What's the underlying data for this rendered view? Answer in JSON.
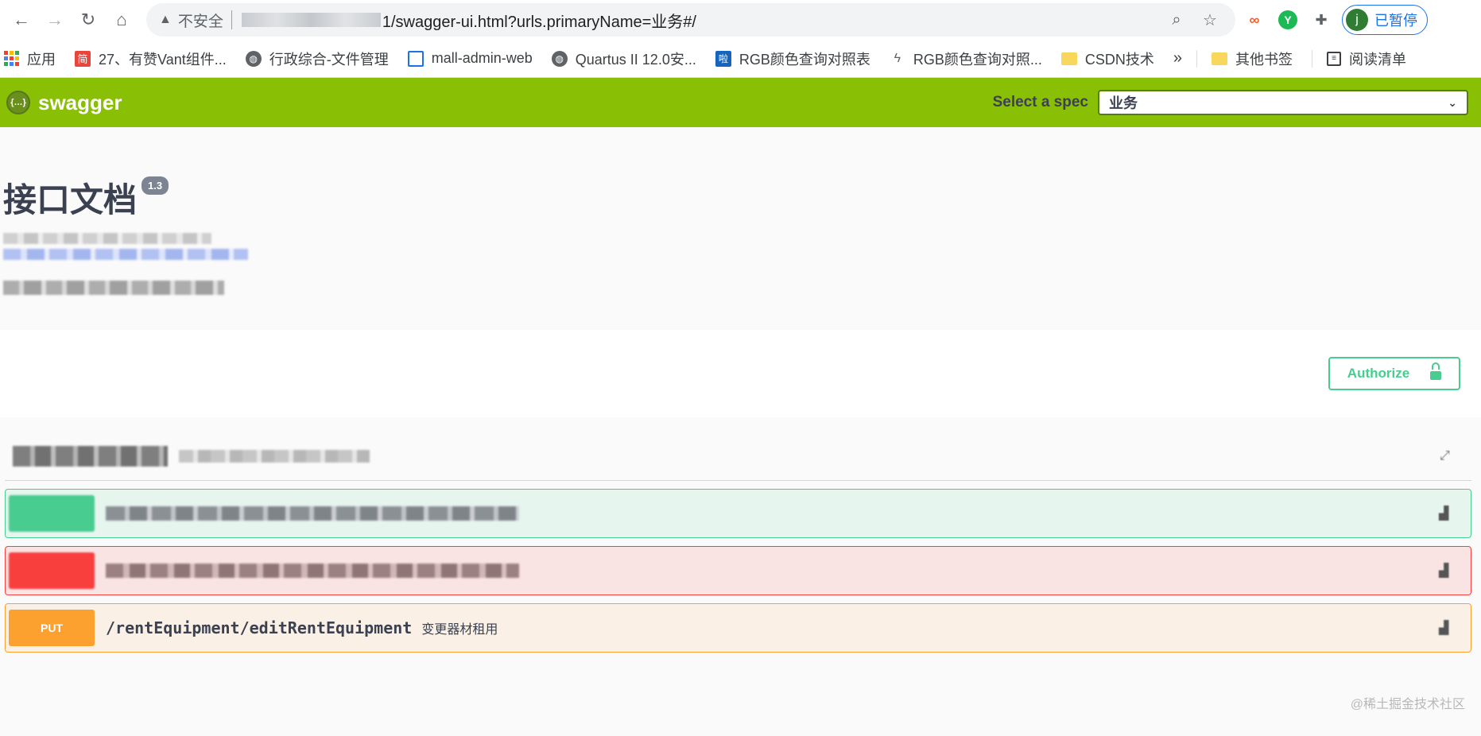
{
  "browser": {
    "insecure_label": "不安全",
    "url_suffix": "1/swagger-ui.html?urls.primaryName=业务#/",
    "profile_initial": "j",
    "profile_label": "已暂停"
  },
  "bookmarks": [
    {
      "label": "应用",
      "icon": "apps-grid-icon"
    },
    {
      "label": "27、有赞Vant组件...",
      "icon": "jian-icon"
    },
    {
      "label": "行政综合-文件管理",
      "icon": "globe-icon"
    },
    {
      "label": "mall-admin-web",
      "icon": "store-icon"
    },
    {
      "label": "Quartus II 12.0安...",
      "icon": "globe-icon"
    },
    {
      "label": "RGB颜色查询对照表",
      "icon": "blue-square-icon"
    },
    {
      "label": "RGB颜色查询对照...",
      "icon": "feather-icon"
    },
    {
      "label": "CSDN技术",
      "icon": "folder-icon"
    }
  ],
  "bookmarks_more": "»",
  "bookmarks_other": "其他书签",
  "bookmarks_reading": "阅读清单",
  "swagger": {
    "brand": "swagger",
    "spec_label": "Select a spec",
    "spec_value": "业务"
  },
  "info": {
    "title": "接口文档",
    "version": "1.3"
  },
  "authorize_label": "Authorize",
  "operations": [
    {
      "method": "",
      "kind": "post"
    },
    {
      "method": "",
      "kind": "delete"
    },
    {
      "method": "PUT",
      "kind": "put",
      "path": "/rentEquipment/editRentEquipment",
      "summary": "变更器材租用"
    }
  ],
  "watermark": "@稀土掘金技术社区",
  "colors": {
    "swagger_green": "#89bf04",
    "post": "#49cc90",
    "delete": "#f93e3e",
    "put": "#fca130"
  }
}
